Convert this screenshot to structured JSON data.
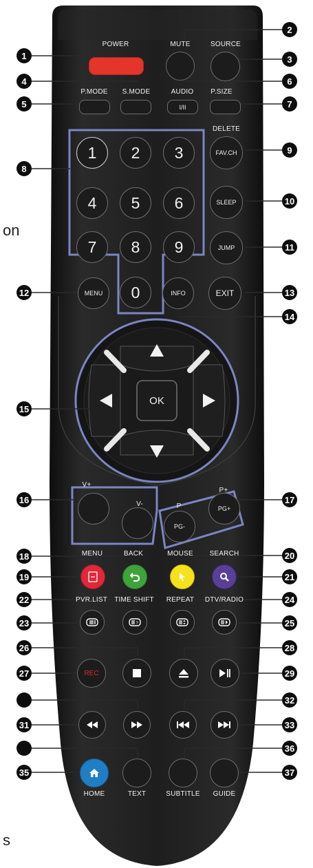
{
  "labels": {
    "power": "POWER",
    "mute": "MUTE",
    "source": "SOURCE",
    "pmode": "P.MODE",
    "smode": "S.MODE",
    "audio": "AUDIO",
    "audio_sub": "I/II",
    "psize": "P.SIZE",
    "delete": "DELETE",
    "favch": "FAV.CH",
    "sleep": "SLEEP",
    "jump": "JUMP",
    "menu": "MENU",
    "info": "INFO",
    "exit": "EXIT",
    "ok": "OK",
    "vplus": "V+",
    "vminus": "V-",
    "p": "P",
    "pplus": "P+",
    "pgplus": "PG+",
    "pgminus": "PG-",
    "menu2": "MENU",
    "back": "BACK",
    "mouse": "MOUSE",
    "search": "SEARCH",
    "pvrlist": "PVR.LIST",
    "timeshift": "TIME SHIFT",
    "repeat": "REPEAT",
    "dtvradio": "DTV/RADIO",
    "rec": "REC",
    "home": "HOME",
    "text": "TEXT",
    "subtitle": "SUBTITLE",
    "guide": "GUIDE"
  },
  "digits": [
    "1",
    "2",
    "3",
    "4",
    "5",
    "6",
    "7",
    "8",
    "9",
    "0"
  ],
  "callouts": [
    "1",
    "2",
    "3",
    "4",
    "5",
    "6",
    "7",
    "8",
    "9",
    "10",
    "11",
    "12",
    "13",
    "14",
    "15",
    "16",
    "17",
    "18",
    "19",
    "20",
    "21",
    "22",
    "23",
    "24",
    "25",
    "26",
    "27",
    "28",
    "29",
    "31",
    "32",
    "33",
    "35",
    "36",
    "37"
  ],
  "edge_text": {
    "top": "on",
    "bottom": "s"
  },
  "colors": {
    "remote_body": "#1b1b1b",
    "power_button": "#e5342a",
    "menu_red": "#e0283a",
    "back_green": "#3fa33b",
    "mouse_yellow": "#f4e21d",
    "search_purple": "#5a3f98",
    "home_blue": "#1f7ec4",
    "rec_text": "#e02a2a",
    "highlight_outline": "#7b86c4"
  },
  "icons": {
    "up": "arrow-up-icon",
    "down": "arrow-down-icon",
    "left": "arrow-left-icon",
    "right": "arrow-right-icon",
    "stop": "stop-icon",
    "eject": "eject-icon",
    "play_pause": "play-pause-icon",
    "rewind": "rewind-icon",
    "fast_forward": "fast-forward-icon",
    "prev": "previous-icon",
    "next": "next-icon",
    "home": "home-icon",
    "search": "magnifier-icon",
    "mouse": "cursor-icon",
    "back": "back-arrow-icon",
    "menu": "menu-icon"
  }
}
